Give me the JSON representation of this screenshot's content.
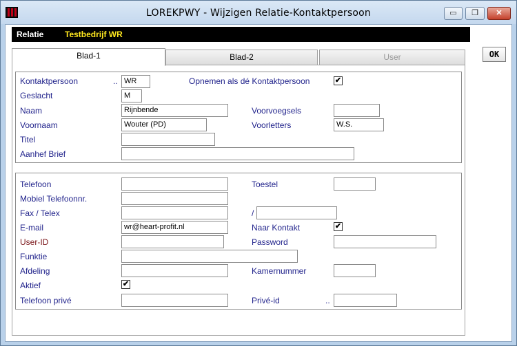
{
  "window": {
    "title": "LOREKPWY - Wijzigen Relatie-Kontaktpersoon",
    "minimize": "▭",
    "maximize": "❐",
    "close": "✕"
  },
  "relatie": {
    "label": "Relatie",
    "value": "Testbedrijf WR"
  },
  "tabs": [
    {
      "label": "Blad-1",
      "state": "active"
    },
    {
      "label": "Blad-2",
      "state": "normal"
    },
    {
      "label": "User",
      "state": "disabled"
    }
  ],
  "ok_button": "OK",
  "group1": {
    "kontaktpersoon": {
      "label": "Kontaktpersoon",
      "dots": "..",
      "value": "WR"
    },
    "opnemen": {
      "label": "Opnemen als dé Kontaktpersoon",
      "checked": "✔"
    },
    "geslacht": {
      "label": "Geslacht",
      "value": "M"
    },
    "naam": {
      "label": "Naam",
      "value": "Rijnbende"
    },
    "voorvoegsels": {
      "label": "Voorvoegsels",
      "value": ""
    },
    "voornaam": {
      "label": "Voornaam",
      "value": "Wouter (PD)"
    },
    "voorletters": {
      "label": "Voorletters",
      "value": "W.S."
    },
    "titel": {
      "label": "Titel",
      "value": ""
    },
    "aanhef": {
      "label": "Aanhef Brief",
      "value": ""
    }
  },
  "group2": {
    "telefoon": {
      "label": "Telefoon",
      "value": ""
    },
    "toestel": {
      "label": "Toestel",
      "value": ""
    },
    "mobiel": {
      "label": "Mobiel Telefoonnr.",
      "value": ""
    },
    "fax": {
      "label": "Fax / Telex",
      "value": "",
      "slash": "/",
      "value2": ""
    },
    "email": {
      "label": "E-mail",
      "value": "wr@heart-profit.nl"
    },
    "naar_kontakt": {
      "label": "Naar Kontakt",
      "checked": "✔"
    },
    "userid": {
      "label": "User-ID",
      "value": ""
    },
    "password": {
      "label": "Password",
      "value": ""
    },
    "functie": {
      "label": "Funktie",
      "value": ""
    },
    "afdeling": {
      "label": "Afdeling",
      "value": ""
    },
    "kamernummer": {
      "label": "Kamernummer",
      "value": ""
    },
    "aktief": {
      "label": "Aktief",
      "checked": "✔"
    },
    "telefoon_prive": {
      "label": "Telefoon privé",
      "value": ""
    },
    "prive_id": {
      "label": "Privé-id",
      "dots": "..",
      "value": ""
    }
  }
}
